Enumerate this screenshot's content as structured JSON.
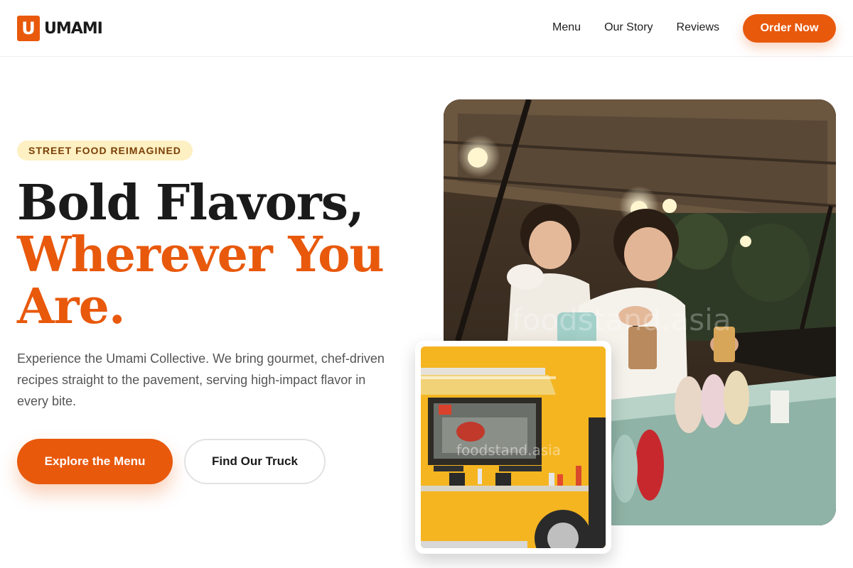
{
  "brand": {
    "mark": "U",
    "name": "UMAMI"
  },
  "nav": {
    "items": [
      "Menu",
      "Our Story",
      "Reviews"
    ],
    "cta": "Order Now"
  },
  "hero": {
    "badge": "STREET FOOD REIMAGINED",
    "headline_line1": "Bold Flavors,",
    "headline_line2": "Wherever You",
    "headline_line3": "Are.",
    "description": "Experience the Umami Collective. We bring gourmet, chef-driven recipes straight to the pavement, serving high-impact flavor in every bite.",
    "primary_button": "Explore the Menu",
    "secondary_button": "Find Our Truck"
  },
  "images": {
    "main_watermark": "foodstand.asia",
    "small_watermark": "foodstand.asia"
  },
  "colors": {
    "accent": "#e8590c",
    "badge_bg": "#fdf0c2",
    "badge_text": "#7a3f07",
    "truck_yellow": "#f4b521"
  }
}
